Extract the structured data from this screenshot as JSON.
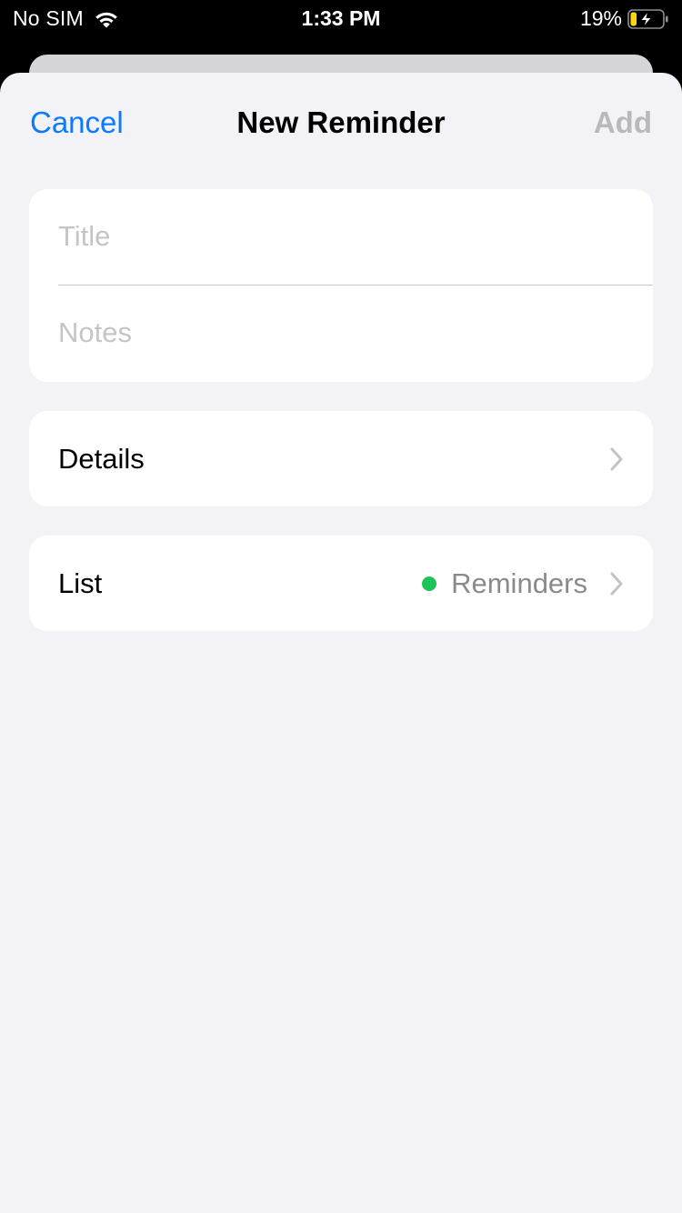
{
  "status_bar": {
    "carrier": "No SIM",
    "time": "1:33 PM",
    "battery_percent": "19%",
    "battery_level": 0.19,
    "battery_charging": true,
    "wifi_icon": "wifi-icon",
    "battery_icon": "battery-charging-icon"
  },
  "nav": {
    "cancel_label": "Cancel",
    "title": "New Reminder",
    "add_label": "Add"
  },
  "form": {
    "title_placeholder": "Title",
    "title_value": "",
    "notes_placeholder": "Notes",
    "notes_value": ""
  },
  "rows": {
    "details_label": "Details",
    "list_label": "List",
    "list_value": "Reminders",
    "chevron_icon": "chevron-right-icon"
  },
  "colors": {
    "accent": "#0a7aff",
    "disabled": "#b9b9bd",
    "list_dot": "#1cc45a",
    "background": "#f2f2f7",
    "battery_fill": "#ffd60a"
  }
}
